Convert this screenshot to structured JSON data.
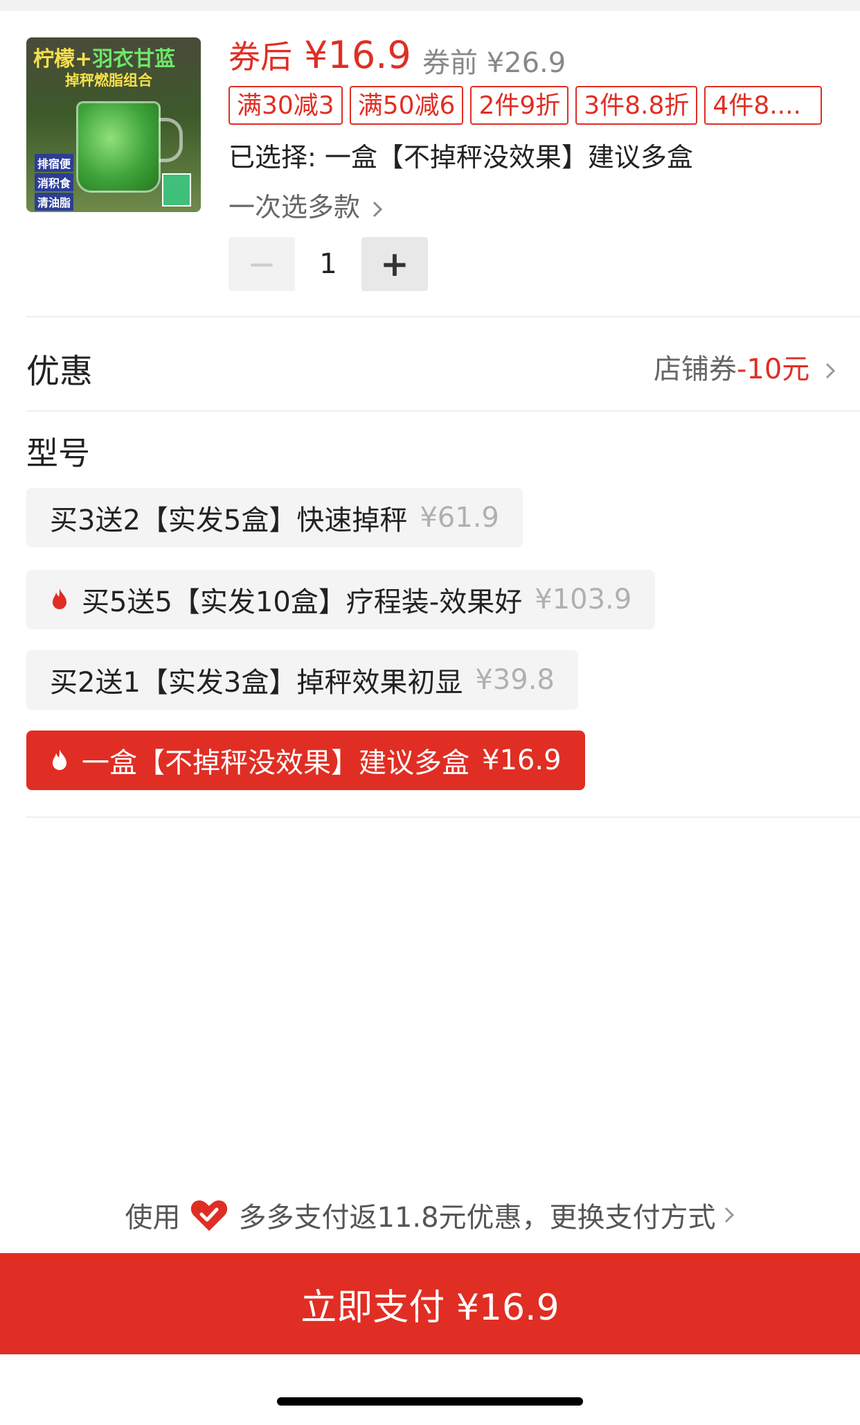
{
  "product": {
    "thumb_title_a": "柠檬+",
    "thumb_title_b": "羽衣甘蓝",
    "thumb_subtitle": "掉秤燃脂组合",
    "thumb_tags": [
      "排宿便",
      "消积食",
      "清油脂"
    ],
    "price_after_label": "券后",
    "price_after": "¥16.9",
    "price_before": "券前 ¥26.9",
    "promos": [
      "满30减3",
      "满50减6",
      "2件9折",
      "3件8.8折",
      "4件8...."
    ],
    "selected": "已选择: 一盒【不掉秤没效果】建议多盒",
    "multi_select": "一次选多款",
    "quantity": "1",
    "minus": "−",
    "plus": "+"
  },
  "discount": {
    "label": "优惠",
    "value_prefix": "店铺券",
    "value_amount": "-10元"
  },
  "model": {
    "title": "型号",
    "options": [
      {
        "label": "买3送2【实发5盒】快速掉秤",
        "price": "¥61.9",
        "hot": false,
        "selected": false
      },
      {
        "label": "买5送5【实发10盒】疗程装-效果好",
        "price": "¥103.9",
        "hot": true,
        "selected": false
      },
      {
        "label": "买2送1【实发3盒】掉秤效果初显",
        "price": "¥39.8",
        "hot": false,
        "selected": false
      },
      {
        "label": "一盒【不掉秤没效果】建议多盒",
        "price": "¥16.9",
        "hot": true,
        "selected": true
      }
    ]
  },
  "payment": {
    "use_label": "使用",
    "method_text": "多多支付返11.8元优惠，更换支付方式",
    "pay_button": "立即支付 ¥16.9"
  },
  "colors": {
    "accent": "#e02e24",
    "muted": "#888888"
  }
}
